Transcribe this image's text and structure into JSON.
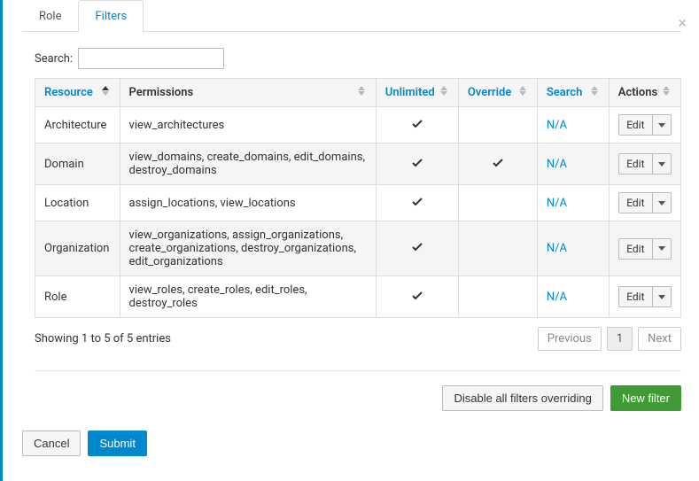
{
  "tabs": {
    "role": "Role",
    "filters": "Filters",
    "active": "filters"
  },
  "search": {
    "label": "Search:",
    "value": ""
  },
  "columns": {
    "resource": "Resource",
    "permissions": "Permissions",
    "unlimited": "Unlimited",
    "override": "Override",
    "search": "Search",
    "actions": "Actions"
  },
  "na_label": "N/A",
  "edit_label": "Edit",
  "rows": [
    {
      "resource": "Architecture",
      "permissions": "view_architectures",
      "unlimited": true,
      "override": false,
      "search": "N/A"
    },
    {
      "resource": "Domain",
      "permissions": "view_domains, create_domains, edit_domains, destroy_domains",
      "unlimited": true,
      "override": true,
      "search": "N/A"
    },
    {
      "resource": "Location",
      "permissions": "assign_locations, view_locations",
      "unlimited": true,
      "override": false,
      "search": "N/A"
    },
    {
      "resource": "Organization",
      "permissions": "view_organizations, assign_organizations, create_organizations, destroy_organizations, edit_organizations",
      "unlimited": true,
      "override": false,
      "search": "N/A"
    },
    {
      "resource": "Role",
      "permissions": "view_roles, create_roles, edit_roles, destroy_roles",
      "unlimited": true,
      "override": false,
      "search": "N/A"
    }
  ],
  "footer": {
    "info": "Showing 1 to 5 of 5 entries",
    "previous": "Previous",
    "page": "1",
    "next": "Next"
  },
  "actions": {
    "disable_override": "Disable all filters overriding",
    "new_filter": "New filter",
    "cancel": "Cancel",
    "submit": "Submit"
  }
}
